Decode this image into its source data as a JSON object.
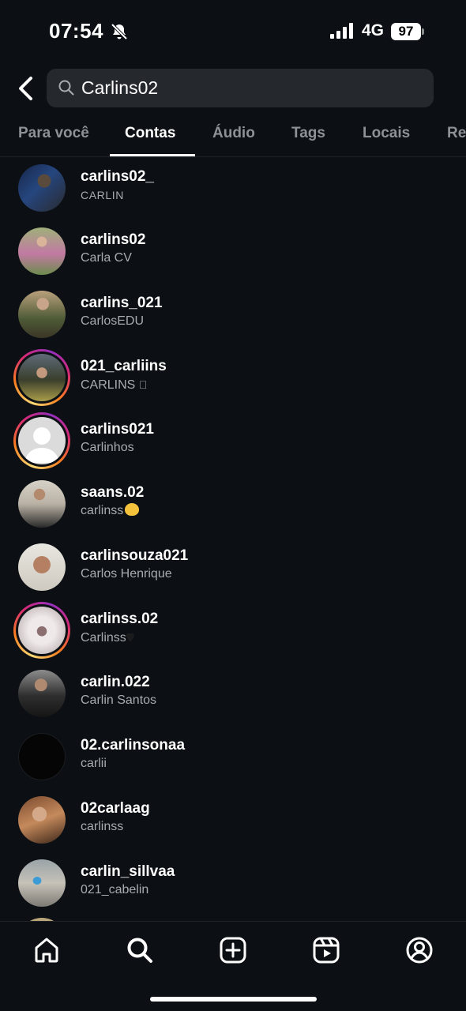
{
  "status_bar": {
    "time": "07:54",
    "network": "4G",
    "battery": "97"
  },
  "search": {
    "query": "Carlins02"
  },
  "tabs": [
    {
      "label": "Para você"
    },
    {
      "label": "Contas"
    },
    {
      "label": "Áudio"
    },
    {
      "label": "Tags"
    },
    {
      "label": "Locais"
    },
    {
      "label": "Re"
    }
  ],
  "results": [
    {
      "username": "carlins02_",
      "name": "CARLIN",
      "story_ring": false,
      "name_emoji": ""
    },
    {
      "username": "carlins02",
      "name": "Carla CV",
      "story_ring": false,
      "name_emoji": ""
    },
    {
      "username": "carlins_021",
      "name": "CarlosEDU",
      "story_ring": false,
      "name_emoji": ""
    },
    {
      "username": "021_carliins",
      "name": "CARLINS",
      "story_ring": true,
      "name_emoji": "apple-icon"
    },
    {
      "username": "carlins021",
      "name": "Carlinhos",
      "story_ring": true,
      "name_emoji": ""
    },
    {
      "username": "saans.02",
      "name": "carlinss",
      "story_ring": false,
      "name_emoji": "kissing-cat-emoji"
    },
    {
      "username": "carlinsouza021",
      "name": "Carlos Henrique",
      "story_ring": false,
      "name_emoji": ""
    },
    {
      "username": "carlinss.02",
      "name": "Carlinss",
      "story_ring": true,
      "name_emoji": "black-heart-emoji"
    },
    {
      "username": "carlin.022",
      "name": "Carlin Santos",
      "story_ring": false,
      "name_emoji": ""
    },
    {
      "username": "02.carlinsonaa",
      "name": "carlii",
      "story_ring": false,
      "name_emoji": ""
    },
    {
      "username": "02carlaag",
      "name": "carlinss",
      "story_ring": false,
      "name_emoji": ""
    },
    {
      "username": "carlin_sillvaa",
      "name": "021_cabelin",
      "story_ring": false,
      "name_emoji": ""
    }
  ],
  "bottom_nav": [
    "home-icon",
    "search-icon",
    "create-icon",
    "reels-icon",
    "profile-icon"
  ],
  "colors": {
    "background": "#0c1014",
    "search_field": "#25292e",
    "secondary_text": "#a8acb1",
    "inactive_tab": "#8e9297"
  }
}
